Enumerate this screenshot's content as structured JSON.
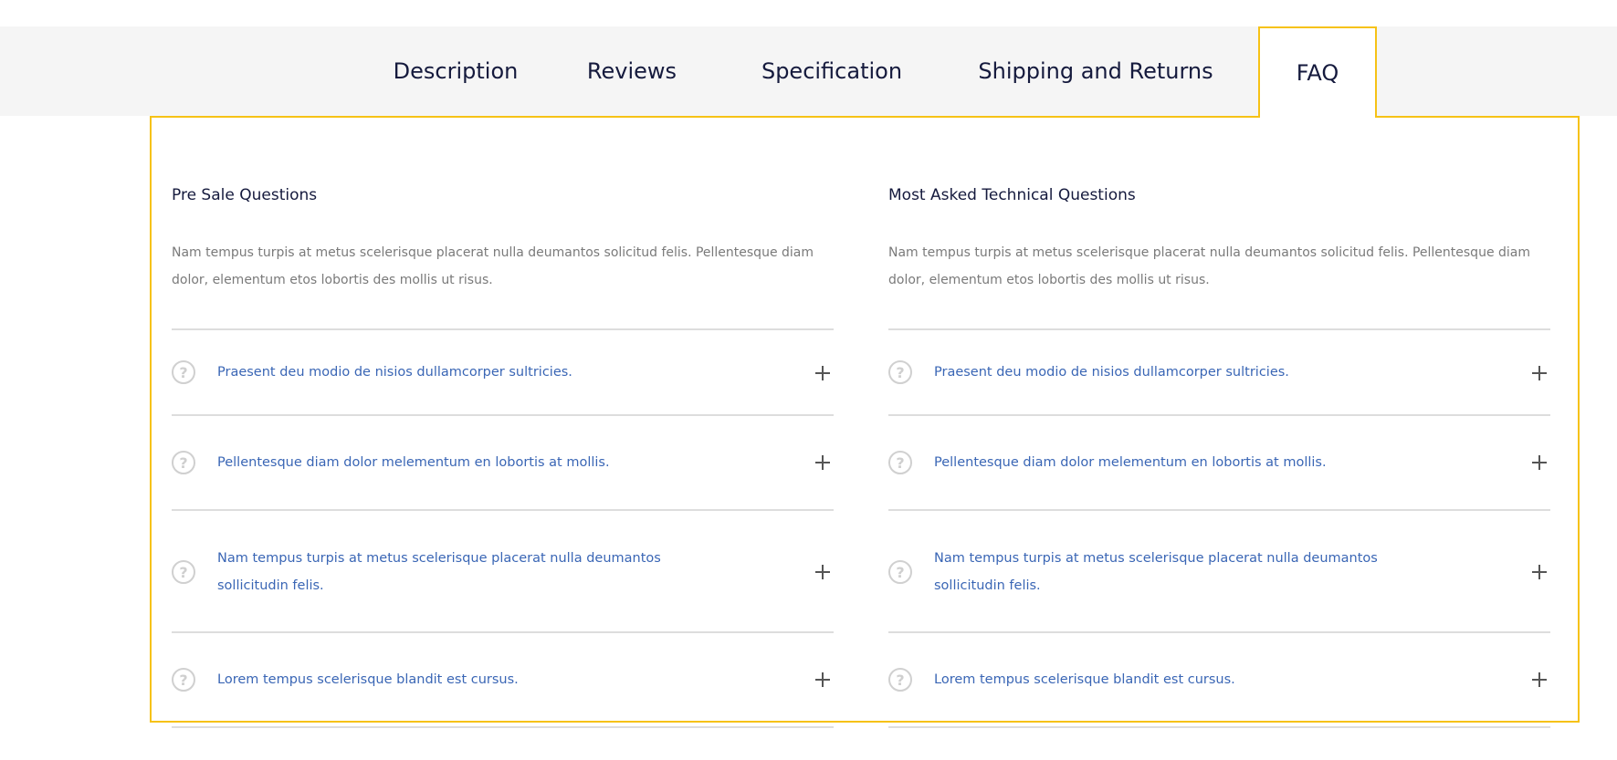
{
  "tabs": [
    {
      "label": "Description"
    },
    {
      "label": "Reviews"
    },
    {
      "label": "Specification"
    },
    {
      "label": "Shipping and Returns"
    },
    {
      "label": "FAQ"
    }
  ],
  "active_tab": "FAQ",
  "colors": {
    "accent": "#f6c216",
    "link": "#3a66b5",
    "heading": "#151a3d",
    "muted": "#7a7a7a"
  },
  "sections": [
    {
      "title": "Pre Sale Questions",
      "description": "Nam tempus turpis at metus scelerisque placerat nulla deumantos solicitud felis. Pellentesque diam dolor, elementum etos lobortis des mollis ut risus.",
      "questions": [
        {
          "icon": "question-circle-icon",
          "text": "Praesent deu modio de nisios dullamcorper sultricies."
        },
        {
          "icon": "question-circle-icon",
          "text": "Pellentesque diam dolor melementum en lobortis at mollis."
        },
        {
          "icon": "question-circle-icon",
          "text": "Nam tempus turpis at metus scelerisque placerat nulla deumantos sollicitudin felis."
        },
        {
          "icon": "question-circle-icon",
          "text": "Lorem tempus scelerisque blandit est cursus."
        }
      ]
    },
    {
      "title": "Most Asked Technical Questions",
      "description": "Nam tempus turpis at metus scelerisque placerat nulla deumantos solicitud felis. Pellentesque diam dolor, elementum etos lobortis des mollis ut risus.",
      "questions": [
        {
          "icon": "question-circle-icon",
          "text": "Praesent deu modio de nisios dullamcorper sultricies."
        },
        {
          "icon": "question-circle-icon",
          "text": "Pellentesque diam dolor melementum en lobortis at mollis."
        },
        {
          "icon": "question-circle-icon",
          "text": "Nam tempus turpis at metus scelerisque placerat nulla deumantos sollicitudin felis."
        },
        {
          "icon": "question-circle-icon",
          "text": "Lorem tempus scelerisque blandit est cursus."
        }
      ]
    }
  ]
}
